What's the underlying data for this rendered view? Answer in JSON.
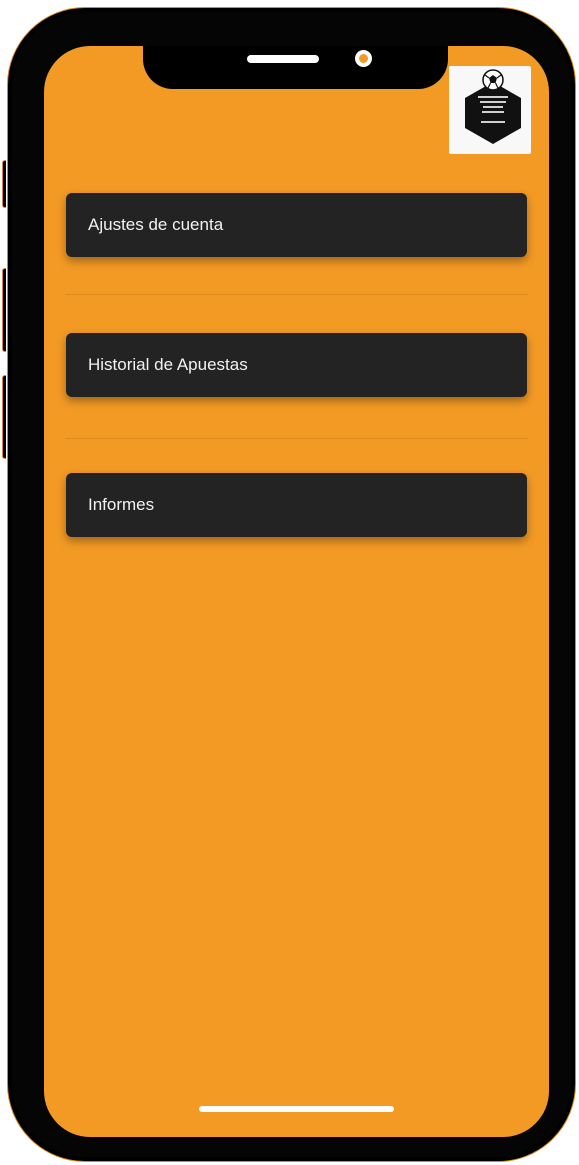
{
  "app": {
    "logo_icon": "soccer-ball-hexagon-logo",
    "background_color": "#f39a25",
    "card_color": "#232323",
    "text_color": "#f2f2f2"
  },
  "menu": {
    "items": [
      {
        "label": "Ajustes de cuenta"
      },
      {
        "label": "Historial de Apuestas"
      },
      {
        "label": "Informes"
      }
    ]
  }
}
